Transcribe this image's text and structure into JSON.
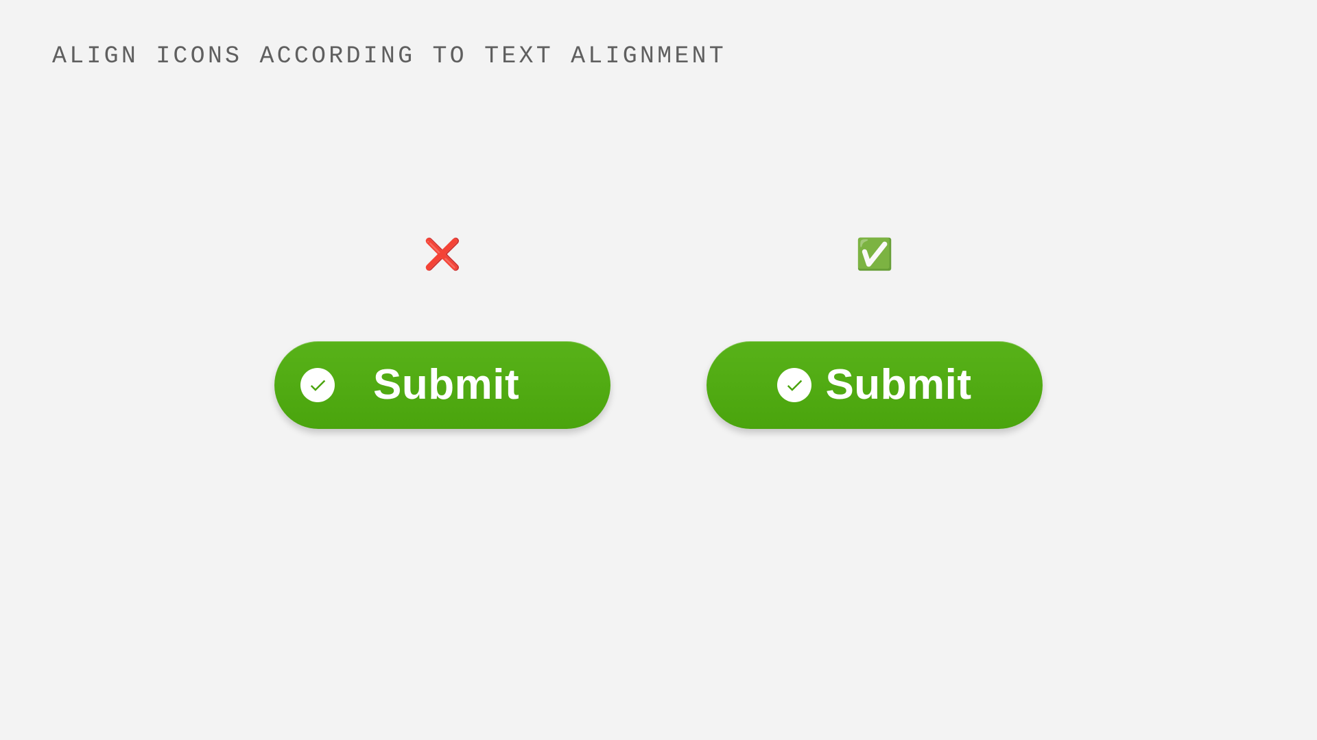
{
  "heading": "ALIGN ICONS ACCORDING TO TEXT ALIGNMENT",
  "indicators": {
    "wrong": "❌",
    "right": "✅"
  },
  "button": {
    "label": "Submit"
  },
  "colors": {
    "button_bg": "#4aa40d",
    "button_text": "#ffffff",
    "heading_text": "#5f5f5f",
    "page_bg": "#f3f3f3",
    "cross": "#d60000",
    "check": "#1fa81f"
  }
}
